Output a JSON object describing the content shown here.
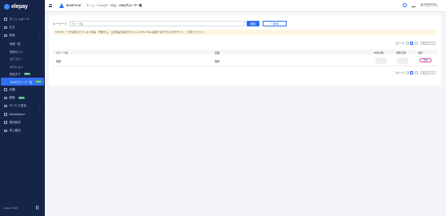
{
  "sidebar": {
    "logo": "elepay",
    "items": [
      {
        "label": "ダッシュボード"
      },
      {
        "label": "注文"
      },
      {
        "label": "商品"
      },
      {
        "label": "商品一覧"
      },
      {
        "label": "商品セット"
      },
      {
        "label": "カテゴリー"
      },
      {
        "label": "オプション"
      },
      {
        "label": "商品タグ",
        "badge": "NEW"
      },
      {
        "label": "KDSグループ一覧",
        "badge": "NEW"
      },
      {
        "label": "店舗"
      },
      {
        "label": "顧客",
        "badge": "NEW"
      },
      {
        "label": "サービス設定"
      },
      {
        "label": "Marketplace"
      },
      {
        "label": "契約設定"
      },
      {
        "label": "売上報告"
      }
    ],
    "footer": "Elepay © 2024"
  },
  "topbar": {
    "shop_name": "ELESTYLE",
    "breadcrumb": [
      "ホーム",
      "OneQR",
      "商品",
      "KDSグループ一覧"
    ],
    "user_name": "ELESTYLE",
    "user_email": "user@elestyle.jp"
  },
  "filter": {
    "keyword_label": "キーワード",
    "keyword_placeholder": "グループ名",
    "search_label": "検索",
    "new_label": "+ 新規"
  },
  "notice": "KDSグループが指定されていない商品・作業する。上記商品を指定されている KDS / Web 画面で表示できるかをすべて、ご注意ください！",
  "pagination": {
    "total": "合計 1 件",
    "prev": "<",
    "page": "1",
    "next": ">",
    "page_size": "50 / ページ"
  },
  "table": {
    "headers": {
      "group": "グループ名",
      "store": "店舗",
      "created": "作成日時",
      "updated": "更新日時",
      "action": "操作"
    },
    "rows": [
      {
        "group": "厨房",
        "store": "厨房",
        "action": "詳細"
      }
    ]
  },
  "colors": {
    "sidebar_bg": "#17244a",
    "active": "#2f6ff0",
    "notice_bg": "#fdf6e3",
    "highlight": "#e84a8a"
  }
}
